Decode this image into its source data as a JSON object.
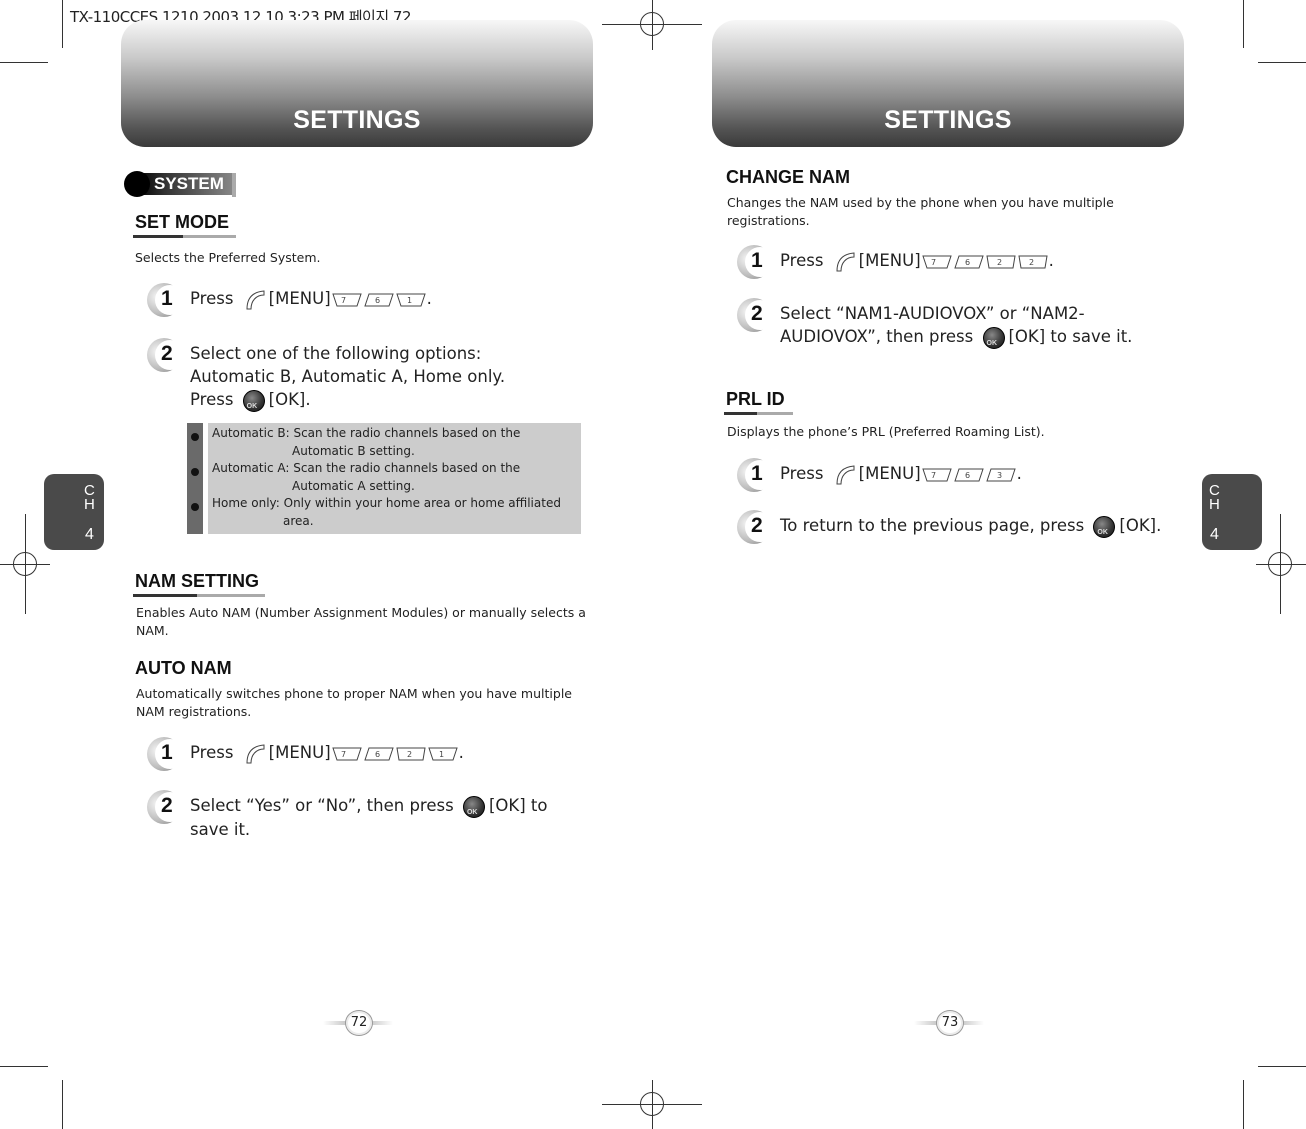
{
  "print_slug": "TX-110CCES 1210  2003.12.10 3:23 PM 페이지 72",
  "left_page": {
    "header_title": "SETTINGS",
    "chapter_tab": {
      "c": "C",
      "h": "H",
      "num": "4"
    },
    "section_badge": "SYSTEM",
    "set_mode": {
      "title": "SET MODE",
      "description": "Selects the Preferred System.",
      "steps": [
        {
          "num": "1",
          "prefix": "Press ",
          "menu": "[MENU]",
          "keys": [
            "7",
            "6",
            "1"
          ],
          "suffix": "."
        },
        {
          "num": "2",
          "lines": [
            "Select one of the following options:",
            "Automatic B, Automatic A, Home only."
          ],
          "press": "Press ",
          "ok": "[OK]."
        }
      ],
      "notes": [
        {
          "label": "Automatic B: Scan the radio channels based on the",
          "cont": "Automatic B setting."
        },
        {
          "label": "Automatic A: Scan the radio channels based on the",
          "cont": "Automatic A setting."
        },
        {
          "label": "Home only: Only within your home area or home affiliated",
          "cont": "area."
        }
      ]
    },
    "nam_setting": {
      "title": "NAM SETTING",
      "description": "Enables Auto NAM (Number Assignment Modules) or manually selects a NAM."
    },
    "auto_nam": {
      "title": "AUTO NAM",
      "description": "Automatically switches phone to proper NAM when you have multiple NAM registrations.",
      "steps": [
        {
          "num": "1",
          "prefix": "Press ",
          "menu": "[MENU]",
          "keys": [
            "7",
            "6",
            "2",
            "1"
          ],
          "suffix": "."
        },
        {
          "num": "2",
          "text": "Select “Yes” or “No”, then press ",
          "ok": "[OK] to",
          "cont": "save it."
        }
      ]
    },
    "page_number": "72"
  },
  "right_page": {
    "header_title": "SETTINGS",
    "chapter_tab": {
      "c": "C",
      "h": "H",
      "num": "4"
    },
    "change_nam": {
      "title": "CHANGE NAM",
      "description": "Changes the NAM used by the phone when you have multiple registrations.",
      "steps": [
        {
          "num": "1",
          "prefix": "Press ",
          "menu": "[MENU]",
          "keys": [
            "7",
            "6",
            "2",
            "2"
          ],
          "suffix": "."
        },
        {
          "num": "2",
          "line1": "Select “NAM1-AUDIOVOX” or “NAM2-",
          "line2": "AUDIOVOX”, then press ",
          "ok": "[OK] to save it."
        }
      ]
    },
    "prl_id": {
      "title": "PRL ID",
      "description": "Displays the phone’s PRL (Preferred Roaming List).",
      "steps": [
        {
          "num": "1",
          "prefix": "Press ",
          "menu": "[MENU]",
          "keys": [
            "7",
            "6",
            "3"
          ],
          "suffix": "."
        },
        {
          "num": "2",
          "text": "To return to the previous page, press ",
          "ok": "[OK]."
        }
      ]
    },
    "page_number": "73"
  },
  "icons": {
    "ok_label": "OK"
  }
}
